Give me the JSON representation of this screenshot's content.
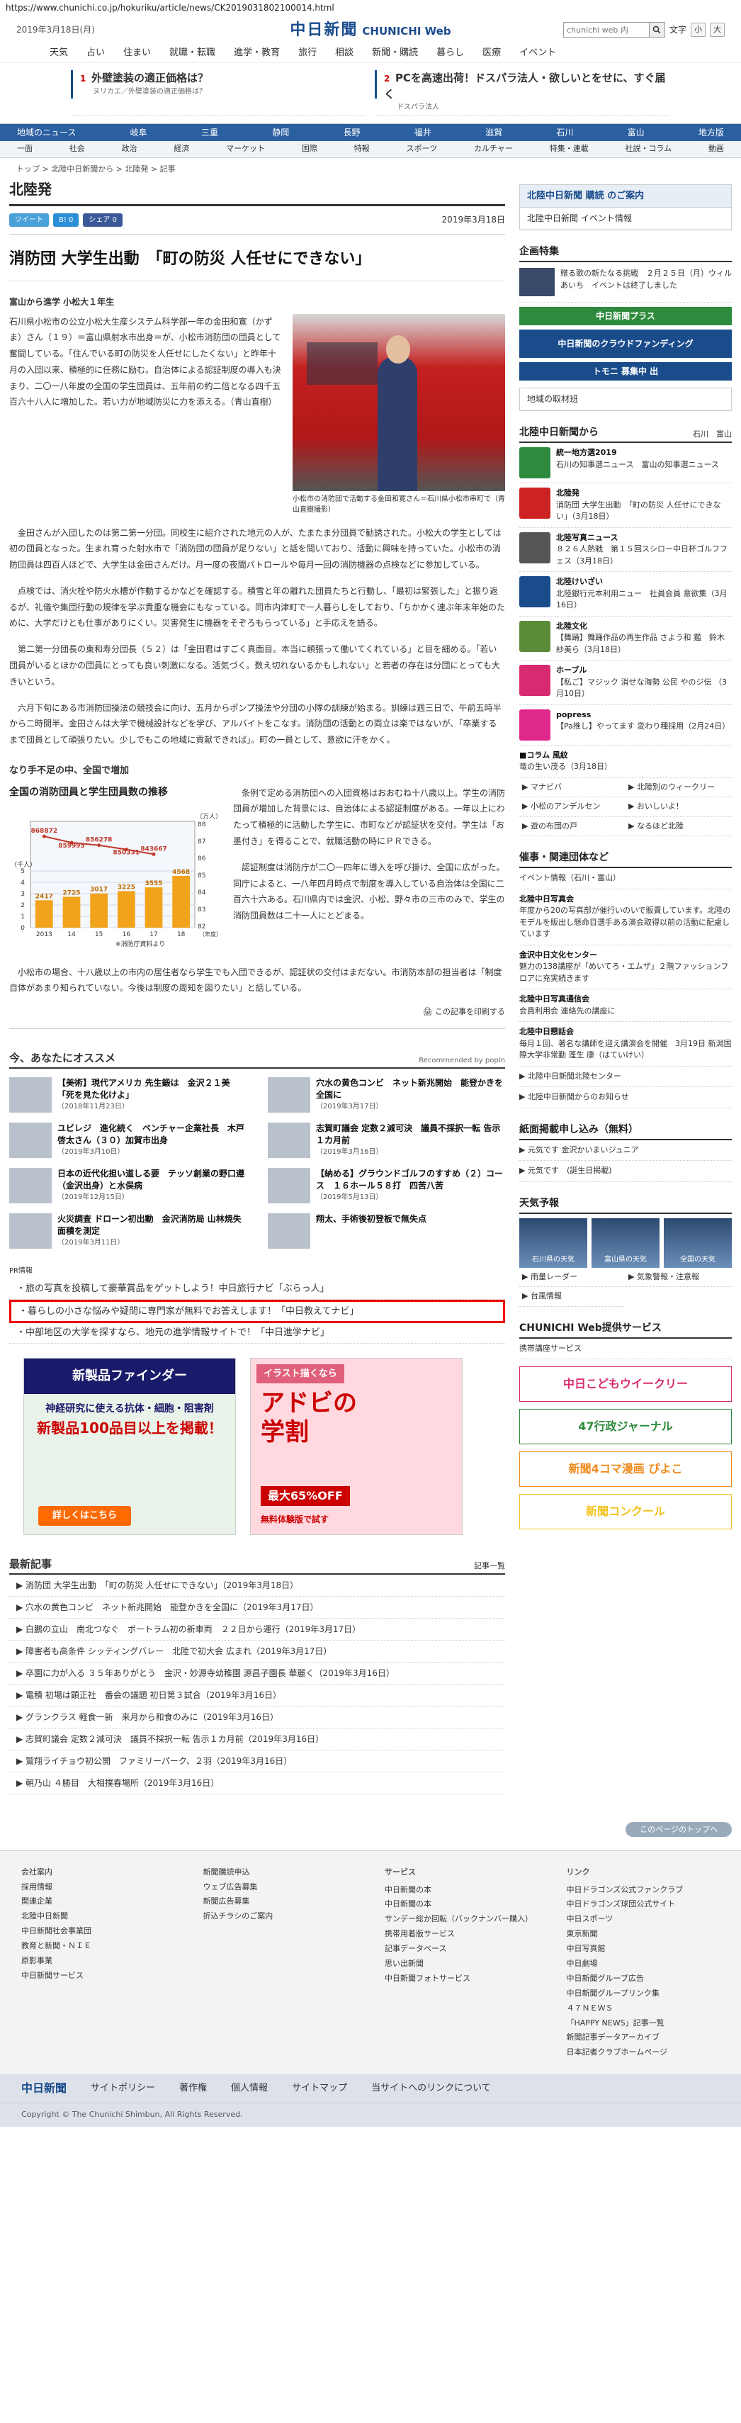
{
  "url": "https://www.chunichi.co.jp/hokuriku/article/news/CK2019031802100014.html",
  "header": {
    "date": "2019年3月18日(月)",
    "logo_ja": "中日新聞",
    "logo_en": "CHUNICHI Web",
    "search_placeholder": "chunichi web 内",
    "search_icon": "search-icon",
    "font_label": "文字",
    "font_s": "小",
    "font_l": "大",
    "nav": [
      "天気",
      "占い",
      "住まい",
      "就職・転職",
      "進学・教育",
      "旅行",
      "相談",
      "新聞・購読",
      "暮らし",
      "医療",
      "イベント"
    ]
  },
  "top_ads": [
    {
      "num": "1",
      "title": "外壁塗装の適正価格は？",
      "sub": "ヌリカエ／外壁塗装の適正価格は？"
    },
    {
      "num": "2",
      "title": "PCを高速出荷！ドスパラ法人・欲しいとをせに、すぐ届く",
      "sub": "ドスパラ法人"
    }
  ],
  "region_nav": [
    "地域のニュース",
    "岐阜",
    "三重",
    "静岡",
    "長野",
    "福井",
    "滋賀",
    "石川",
    "富山",
    "地方版"
  ],
  "cat_nav": [
    "一面",
    "社会",
    "政治",
    "経済",
    "マーケット",
    "国際",
    "特報",
    "スポーツ",
    "カルチャー",
    "特集・連載",
    "社説・コラム",
    "動画"
  ],
  "breadcrumb": "トップ > 北陸中日新聞から > 北陸発 > 記事",
  "section_title": "北陸発",
  "share": {
    "tweet": "ツイート",
    "hatena": "B! 0",
    "facebook": "シェア 0"
  },
  "article": {
    "date": "2019年3月18日",
    "headline": "消防団 大学生出動　「町の防災 人任せにできない」",
    "byline": "富山から進学 小松大１年生",
    "lead": "石川県小松市の公立小松大生産システム科学部一年の金田和寛（かずま）さん（１９）＝富山県射水市出身＝が、小松市消防団の団員として奮闘している。「住んでいる町の防災を人任せにしたくない」と昨年十月の入団以来、積極的に任務に励む。自治体による認証制度の導入も決まり、二〇一八年度の全国の学生団員は、五年前の約二倍となる四千五百六十八人に増加した。若い力が地域防災に力を添える。（青山直樹）",
    "photo_caption": "小松市の消防団で活動する金田和寛さん＝石川県小松市串町で（青山直樹撮影）",
    "paragraphs": [
      "金田さんが入団したのは第二第一分団。同校生に紹介された地元の人が、たまたま分団員で勧誘された。小松大の学生としては初の団員となった。生まれ育った射水市で「消防団の団員が足りない」と話を聞いており、活動に興味を持っていた。小松市の消防団員は四百人ほどで、大学生は金田さんだけ。月一度の夜間パトロールや毎月一回の消防機器の点検などに参加している。",
      "点検では、消火栓や防火水槽が作動するかなどを確認する。積雪と年の離れた団員たちと行動し、「最初は緊張した」と振り返るが、礼儀や集団行動の規律を学ぶ貴重な機会にもなっている。同市内津町で一人暮らしをしており、「ちかかく連ぶ年末年始のために、大学だけとも仕事がありにくい。災害発生に機器をそぞろもらっている」と手応えを語る。",
      "第二第一分団長の東和寿分団長（５２）は「金田君はすごく真面目。本当に頼張って働いてくれている」と目を細める。「若い団員がいるとほかの団員にとっても良い刺激になる。活気づく。数え切れないるかもしれない」と若者の存在は分団にとっても大きいという。",
      "六月下旬にある市消防団操法の競技会に向け、五月からポンプ操法や分団の小隊の訓練が始まる。訓練は週三日で、午前五時半から二時間半。金田さんは大学で機械設計などを学び、アルバイトをこなす。消防団の活動との両立は楽ではないが、「卒業するまで団員として頑張りたい。少しでもこの地域に貢献できれば」。町の一員として、意欲に汗をかく。"
    ],
    "subhead": "なり手不足の中、全国で増加",
    "chart_paragraphs": [
      "条例で定める消防団への入団資格はおおむね十八歳以上。学生の消防団員が増加した背景には、自治体による認証制度がある。一年以上にわたって積極的に活動した学生に、市町などが認証状を交付。学生は「お墨付き」を得ることで、就職活動の時にＰＲできる。",
      "認証制度は消防庁が二〇一四年に導入を呼び掛け、全国に広がった。同庁によると、一八年四月時点で制度を導入している自治体は全国に二百六十六ある。石川県内では金沢、小松、野々市の三市のみで、学生の消防団員数は二十一人にとどまる。"
    ],
    "closing": "小松市の場合、十八歳以上の市内の居住者なら学生でも入団できるが、認証状の交付はまだない。市消防本部の担当者は「制度自体があまり知られていない。今後は制度の周知を図りたい」と話している。",
    "print_label": "この記事を印刷する"
  },
  "chart_data": {
    "type": "line+bar",
    "title": "全国の消防団員と学生団員数の推移",
    "unit_left": "（千人）",
    "unit_right": "（万人）",
    "categories": [
      "2013",
      "14",
      "15",
      "16",
      "17",
      "18"
    ],
    "x_suffix": "（年度）",
    "series": [
      {
        "name": "消防団員数",
        "type": "line",
        "values": [
          868872,
          859995,
          856278,
          850331,
          843667
        ]
      },
      {
        "name": "学生団員数",
        "type": "bar",
        "values": [
          2417,
          2725,
          3017,
          3225,
          3555,
          4568
        ]
      }
    ],
    "line_labels": [
      "868872",
      "859995",
      "856278",
      "850331",
      "843667"
    ],
    "bar_labels": [
      "2417",
      "2725",
      "3017",
      "3225",
      "3555",
      "4568"
    ],
    "left_ticks": [
      "5",
      "4",
      "3",
      "2",
      "1",
      "0"
    ],
    "right_ticks": [
      "88",
      "87",
      "86",
      "85",
      "84",
      "83",
      "82"
    ],
    "source": "※消防庁資料より"
  },
  "recommend": {
    "title": "今、あなたにオススメ",
    "powered": "Recommended by popIn",
    "items": [
      {
        "title": "【美術】現代アメリカ 先生鍛は　金沢２１美「死を見た化けよ」",
        "date": "（2018年11月23日）"
      },
      {
        "title": "穴水の黄色コンビ　ネット新兆開始　能登かきを全国に",
        "date": "（2019年3月17日）"
      },
      {
        "title": "ユビレジ　進化続く　ベンチャー企業社長　木戸啓太さん（３０）加賀市出身",
        "date": "（2019年3月10日）"
      },
      {
        "title": "志賀町議会 定数２減可決　議員不採択一転 告示１カ月前",
        "date": "（2019年3月16日）"
      },
      {
        "title": "日本の近代化担い道しる要　テッソ創業の野口遵（金沢出身）と水俣病",
        "date": "（2019年12月15日）"
      },
      {
        "title": "【納める】グラウンドゴルフのすすめ（２）コース　１６ホール５８打　四苦八苦",
        "date": "（2019年5月13日）"
      },
      {
        "title": "火災調査 ドローン初出動　金沢消防局 山林焼失面積を測定",
        "date": "（2019年3月11日）"
      },
      {
        "title": "翔太、手術後初登板で無失点",
        "date": ""
      }
    ]
  },
  "pr": {
    "label": "PR情報",
    "items": [
      "旅の写真を投稿して豪華賞品をゲットしよう！中日旅行ナビ「ぶらっ人」",
      "暮らしの小さな悩みや疑問に専門家が無料でお答えします！「中日教えてナビ」",
      "中部地区の大学を探すなら、地元の進学情報サイトで！「中日進学ナビ」"
    ]
  },
  "banner1": {
    "title": "新製品ファインダー",
    "body1": "神経研究に使える抗体・細胞・阻害剤",
    "body2": "新製品100品目以上を掲載！",
    "button": "詳しくはこちら"
  },
  "banner2": {
    "top": "イラスト描くなら",
    "brand": "アドビの",
    "big": "学割",
    "discount": "最大65%OFF",
    "cta": "無料体験版で試す"
  },
  "latest": {
    "title": "最新記事",
    "more": "記事一覧",
    "items": [
      "消防団 大学生出動　「町の防災 人任せにできない」（2019年3月18日）",
      "穴水の黄色コンビ　ネット新兆開始　能登かきを全国に（2019年3月17日）",
      "白鵬の立山　南北つなぐ　ボートラム初の新車両　２２日から運行（2019年3月17日）",
      "障害者も高条件 シッティングバレー　北陸で初大会 広まれ（2019年3月17日）",
      "卒園に力が入る ３５年ありがとう　金沢・妙源寺幼稚園 源昌子園長 華麗く（2019年3月16日）",
      "電積 初場は顕正社　番会の議題 初日第３試合（2019年3月16日）",
      "グランクラス 軽食一新　来月から和食のみに（2019年3月16日）",
      "志賀町議会 定数２減可決　議員不採択一転 告示１カ月前（2019年3月16日）",
      "鷲翔ライチョウ初公開　ファミリーパーク、２羽（2019年3月16日）",
      "朝乃山 ４勝目　大相撲春場所（2019年3月16日）"
    ]
  },
  "sidebar": {
    "hokuriku_title": "北陸中日新聞",
    "hokuriku_sub": "購読 のご案内",
    "events_title": "北陸中日新聞 イベント情報",
    "feature_title": "企画特集",
    "feature_item": "贈る歌の新たなる挑戦　２月２５日（月）ウィルあいち　イベントは終了しました",
    "plus_banner": "中日新聞プラス",
    "funding_banner": "中日新聞のクラウドファンディング",
    "tomoni_banner": "トモニ 募集中 出",
    "local_material": "地域の取材班",
    "news_title": "北陸中日新聞から",
    "news_more": "石川　富山",
    "news": [
      {
        "tag": "統一地方選2019",
        "text": "石川の知事選ニュース　富山の知事選ニュース",
        "color": "#2e8b3d",
        "icon": "election-icon"
      },
      {
        "tag": "北陸発",
        "text": "消防団 大学生出動　「町の防災 人任せにできない」（3月18日）",
        "color": "#cc2222",
        "icon": "firetruck-icon"
      },
      {
        "tag": "北陸写真ニュース",
        "text": "８２６人熱戦　第１５回スシロー中日杯ゴルフフェス（3月18日）",
        "color": "#555555",
        "icon": "camera-icon"
      },
      {
        "tag": "北陸けいざい",
        "text": "北陸銀行元本利用ニュー　社員会員 意欲集（3月16日）",
        "color": "#1a4c8c",
        "icon": "chart-icon"
      },
      {
        "tag": "北陸文化",
        "text": "【舞踊】舞踊作品の再生作品 さよう和 鑑　鈴木紗美ら（3月18日）",
        "color": "#5a8c3a",
        "icon": "culture-icon"
      },
      {
        "tag": "ホーブル",
        "text": "【私ご】マジック 消せな海勢 公民 やのジ伝 （3月10日）",
        "color": "#d82a70",
        "icon": "hoburu-icon"
      },
      {
        "tag": "popress",
        "text": "【Pa推し】やってます 変わり種採用（2月24日）",
        "color": "#e0288c",
        "icon": "popress-icon"
      }
    ],
    "column_label": "■コラム 風紋",
    "column_date": "竜の生い茂る（3月18日）",
    "links": [
      "マナビバ",
      "北陸別のウィークリー",
      "小松のアンデルセン",
      "おいしいよ！",
      "遊の布団の戸",
      "なるほど北陸"
    ],
    "events_head": "催事・関連団体など",
    "events_link": "イベント情報（石川・富山）",
    "events": [
      {
        "t": "北陸中日写真会",
        "d": "年度から20の写真部が催行いのいで販賣しています。北陸のモデルを販出し懸命目選手ある演会取得以前の活動に配慮しています"
      },
      {
        "t": "金沢中日文化センター",
        "d": "魅力の138講座が「めいてろ・エムザ」２階ファッションフロアに充実続きます"
      },
      {
        "t": "北陸中日写真通信会",
        "d": "会員利用会 連絡先の講座に"
      },
      {
        "t": "北陸中日懇話会",
        "d": "毎月１回、著名な講師を迎え講演会を開催　3月19日 新潟国際大学非常勤 蓬生 康（はていけい）"
      }
    ],
    "extra_links": [
      "北陸中日新聞北陸センター",
      "北陸中日新聞からのお知らせ"
    ],
    "paper_title": "紙面掲載申し込み（無料）",
    "paper_links": [
      "元気です 金沢かいまいジュニア",
      "元気です　(誕生日掲載)"
    ],
    "weather_title": "天気予報",
    "weather": [
      "石川県の天気",
      "富山県の天気",
      "全国の天気"
    ],
    "weather_links": [
      "雨量レーダー",
      "気象警報・注意報",
      "台風情報"
    ],
    "service_title": "CHUNICHI Web提供サービス",
    "service_link": "携帯講座サービス",
    "service_banners": [
      "中日こどもウイークリー",
      "47行政ジャーナル",
      "新聞4コマ漫画 ぴよこ",
      "新聞コンクール"
    ]
  },
  "pagetop": "このページのトップへ",
  "footer": {
    "col1_head": "",
    "col1": [
      "会社案内",
      "採用情報",
      "関連企業",
      "北陸中日新聞",
      "中日新聞社会事業団",
      "教育と新聞・ＮＩＥ",
      "原影事業",
      "中日新聞サービス"
    ],
    "col2": [
      "新聞購読申込",
      "ウェブ広告募集",
      "新聞広告募集",
      "折込チラシのご案内"
    ],
    "col3_head": "サービス",
    "col3": [
      "中日新聞の本",
      "中日新聞の本",
      "サンデー総か回転（バックナンバー購入）",
      "携帯用着版サービス",
      "記事データベース",
      "思い出新聞",
      "中日新聞フォトサービス"
    ],
    "col4_head": "リンク",
    "col4": [
      "中日ドラゴンズ公式ファンクラブ",
      "中日ドラゴンズ球団公式サイト",
      "中日スポーツ",
      "東京新聞",
      "中日写真館",
      "中日劇場",
      "中日新聞グループ広告",
      "中日新聞グループリンク集",
      "４７ＮＥＷＳ",
      "「HAPPY NEWS」記事一覧",
      "新聞記事データアーカイブ",
      "日本記者クラブホームページ"
    ],
    "bar": [
      "サイトポリシー",
      "著作権",
      "個人情報",
      "サイトマップ",
      "当サイトへのリンクについて"
    ],
    "bar_logo": "中日新聞",
    "copyright": "Copyright © The Chunichi Shimbun, All Rights Reserved."
  }
}
